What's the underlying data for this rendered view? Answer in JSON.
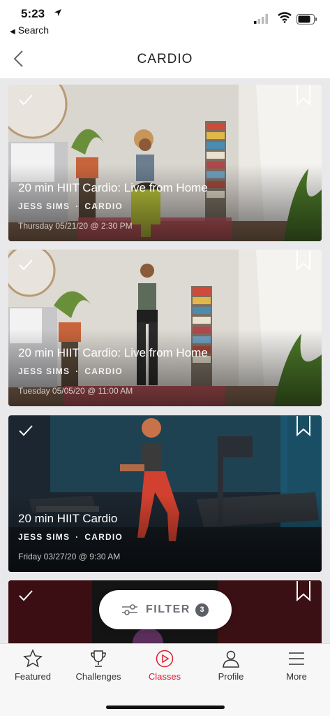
{
  "status_bar": {
    "time": "5:23",
    "back_app": "Search"
  },
  "nav": {
    "title": "CARDIO"
  },
  "classes": [
    {
      "title": "20 min HIIT Cardio: Live from Home",
      "instructor": "JESS SIMS",
      "category": "CARDIO",
      "date": "Thursday 05/21/20 @ 2:30 PM"
    },
    {
      "title": "20 min HIIT Cardio: Live from Home",
      "instructor": "JESS SIMS",
      "category": "CARDIO",
      "date": "Tuesday 05/05/20 @ 11:00 AM"
    },
    {
      "title": "20 min HIIT Cardio",
      "instructor": "JESS SIMS",
      "category": "CARDIO",
      "date": "Friday 03/27/20 @ 9:30 AM"
    }
  ],
  "filter": {
    "label": "FILTER",
    "count": "3"
  },
  "tabs": [
    {
      "label": "Featured",
      "icon": "star-icon"
    },
    {
      "label": "Challenges",
      "icon": "trophy-icon"
    },
    {
      "label": "Classes",
      "icon": "play-circle-icon"
    },
    {
      "label": "Profile",
      "icon": "person-icon"
    },
    {
      "label": "More",
      "icon": "menu-icon"
    }
  ],
  "colors": {
    "accent": "#df1c2f",
    "filter_badge": "#5c6066"
  }
}
